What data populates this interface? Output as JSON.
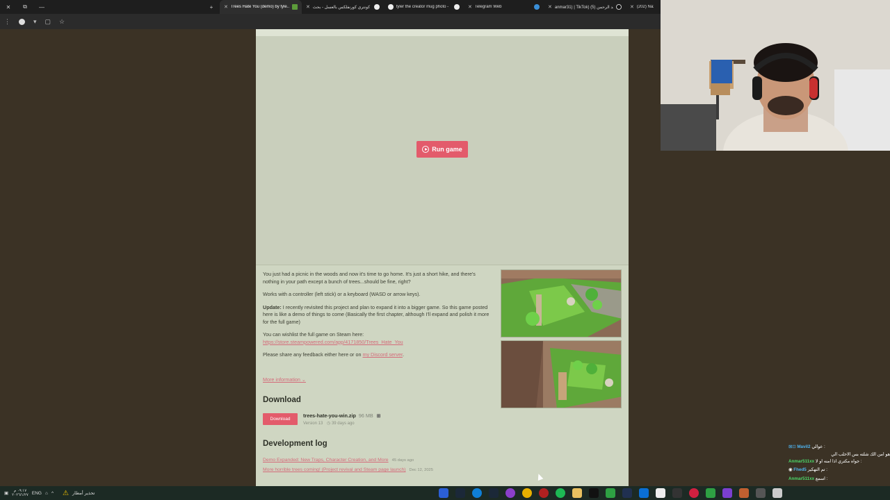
{
  "browser": {
    "tabs": [
      {
        "label": "Trees Hate You (demo) by tyle...",
        "active": true
      },
      {
        "label": "كونتري كورنفلكس بالعسل - بحث",
        "active": false
      },
      {
        "label": "tyler the creator mug photo -",
        "active": false
      },
      {
        "label": "Telegram Web",
        "active": false
      },
      {
        "label": "anmar31) | TikTok) عبد الرحمن (5)",
        "active": false
      },
      {
        "label": "(202) Naz",
        "active": false
      }
    ],
    "new_tab": "+"
  },
  "game": {
    "run_label": "Run game"
  },
  "description": {
    "p1": "You just had a picnic in the woods and now it's time to go home. It's just a short hike, and there's nothing in your path except a bunch of trees...should be fine, right?",
    "p2": "Works with a controller (left stick) or a keyboard (WASD or arrow keys).",
    "p3_bold": "Update:",
    "p3": " I recently revisited this project and plan to expand it into a bigger game. So this game posted here is like a demo of things to come (Basically the first chapter, although I'll expand and polish it more for the full game)",
    "p4": "You can wishlist the full game on Steam here: ",
    "steam_link": "https://store.steampowered.com/app/4171850/Trees_Hate_You",
    "p5": "Please share any feedback either here or on ",
    "discord_link": "my Discord server",
    "p5_end": ".",
    "more_info": "More information ⌄"
  },
  "download": {
    "heading": "Download",
    "button": "Download",
    "file_name": "trees-hate-you-win.zip",
    "file_size": "96 MB",
    "version": "Version 13",
    "age": "39 days ago"
  },
  "devlog": {
    "heading": "Development log",
    "entries": [
      {
        "title": "Demo Expanded: New Traps, Character Creation, and More",
        "date": "45 days ago"
      },
      {
        "title": "More horrible trees coming! (Project revival and Steam page launch)",
        "date": "Dec 12, 2025"
      }
    ]
  },
  "chat": [
    {
      "name": "Mavil2",
      "msg": "عوالي :"
    },
    {
      "name": "",
      "msg": "هو امن الك شلته بس الاحلب الي"
    },
    {
      "name": "Anmar511xx",
      "msg": "جواه مكتري اذا امنه او لا :"
    },
    {
      "name": "Fhed5",
      "msg": "تم التهكير :"
    },
    {
      "name": "Anmar511xx",
      "msg": "اسمع :"
    }
  ],
  "taskbar": {
    "weather": "تحذير أمطار",
    "lang": "ENG",
    "time": "٠٩:١٧ م",
    "date": "٢٠٢٦/١/٢٧"
  }
}
